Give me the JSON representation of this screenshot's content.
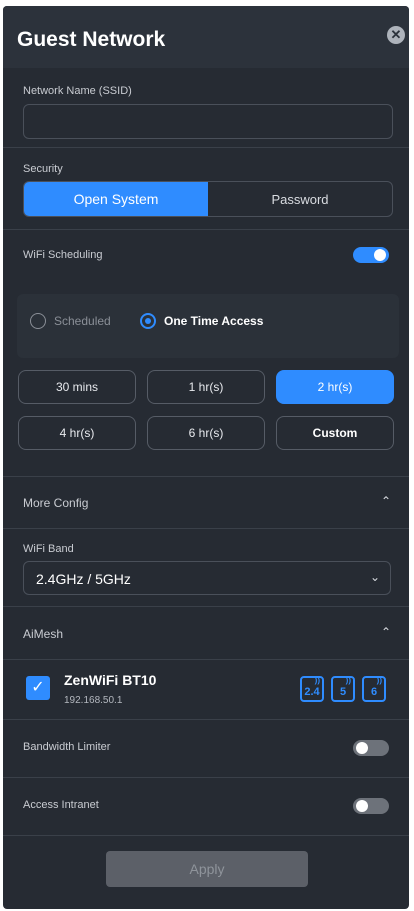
{
  "header": {
    "title": "Guest Network"
  },
  "ssid": {
    "label": "Network Name (SSID)",
    "value": ""
  },
  "security": {
    "label": "Security",
    "options": [
      "Open System",
      "Password"
    ],
    "selected": "Open System"
  },
  "scheduling": {
    "label": "WiFi Scheduling",
    "enabled": true
  },
  "schedule_mode": {
    "options": [
      "Scheduled",
      "One Time Access"
    ],
    "selected": "One Time Access"
  },
  "durations": [
    "30 mins",
    "1 hr(s)",
    "2 hr(s)",
    "4 hr(s)",
    "6 hr(s)",
    "Custom"
  ],
  "duration_selected": "2 hr(s)",
  "more_config": {
    "label": "More Config"
  },
  "wifi_band": {
    "label": "WiFi Band",
    "value": "2.4GHz / 5GHz"
  },
  "aimesh": {
    "label": "AiMesh",
    "node": {
      "name": "ZenWiFi BT10",
      "ip": "192.168.50.1",
      "checked": true,
      "bands": [
        "2.4",
        "5",
        "6"
      ]
    }
  },
  "bandwidth_limiter": {
    "label": "Bandwidth Limiter",
    "enabled": false
  },
  "access_intranet": {
    "label": "Access Intranet",
    "enabled": false
  },
  "apply_label": "Apply",
  "colors": {
    "accent": "#2f8cff",
    "panel": "#262b33",
    "disabled": "#5c6068"
  }
}
